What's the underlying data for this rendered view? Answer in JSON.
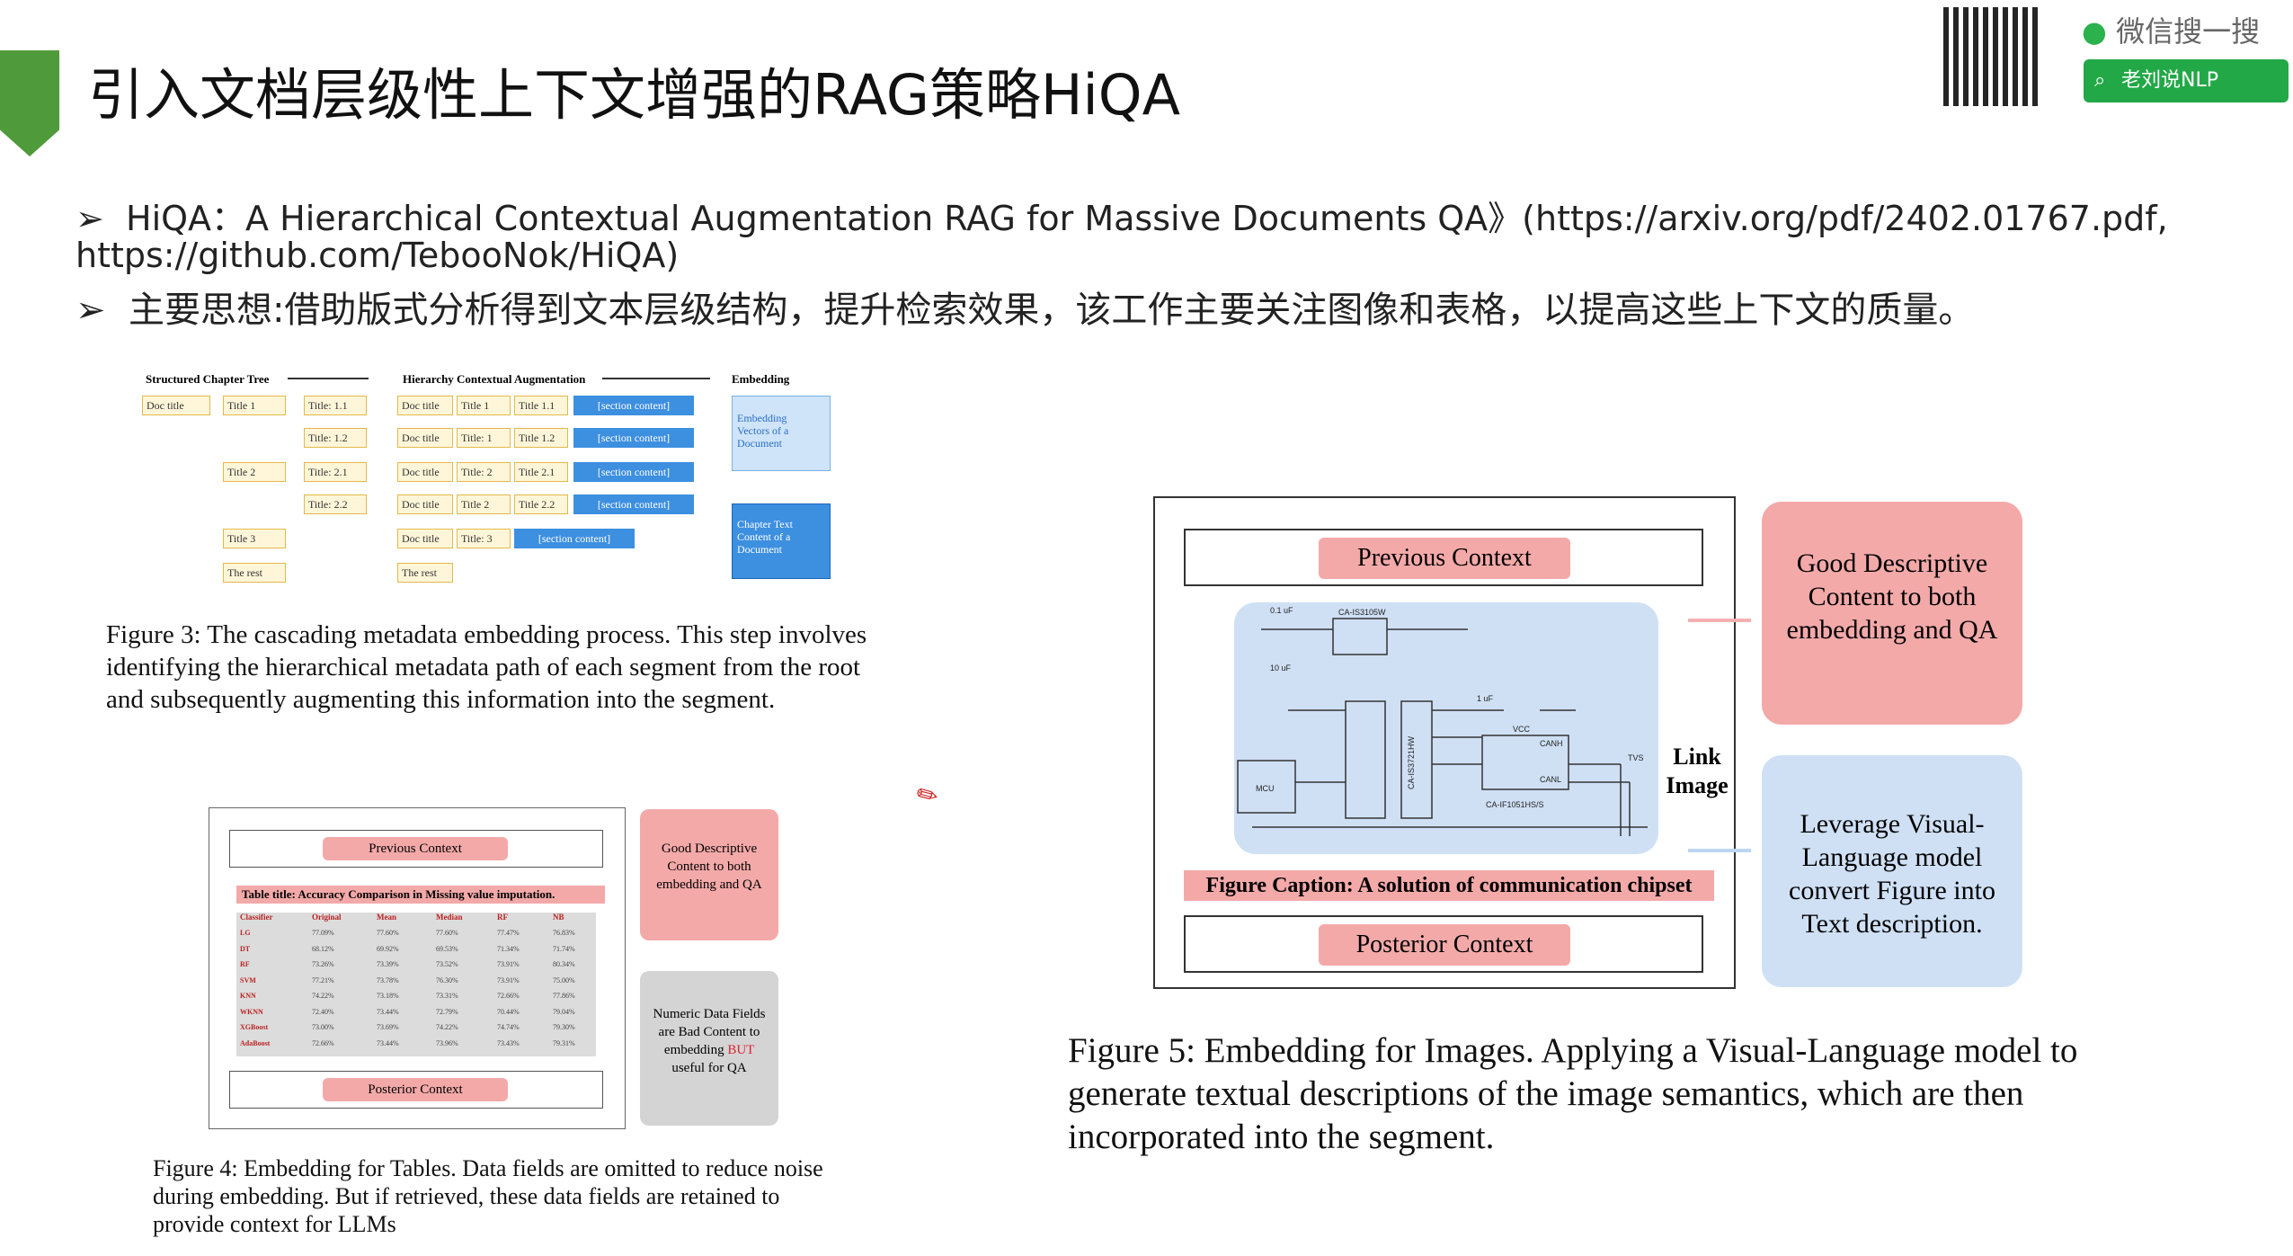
{
  "slide": {
    "title": "引入文档层级性上下文增强的RAG策略HiQA",
    "bullets": [
      "HiQA：A Hierarchical Contextual Augmentation RAG for Massive Documents QA》(https://arxiv.org/pdf/2402.01767.pdf,",
      "https://github.com/TebooNok/HiQA)",
      "主要思想:借助版式分析得到文本层级结构，提升检索效果，该工作主要关注图像和表格，以提高这些上下文的质量。"
    ],
    "bullet_symbol": "➢"
  },
  "watermark": {
    "qr_label": "qr-code",
    "wechat_text": "微信搜一搜",
    "search_label": "老刘说NLP"
  },
  "fig3": {
    "headers": [
      "Structured Chapter Tree",
      "Hierarchy Contextual Augmentation",
      "Embedding"
    ],
    "tree": [
      "Doc title",
      "Title 1",
      "Title: 1.1",
      "Title: 1.2",
      "Title 2",
      "Title: 2.1",
      "Title: 2.2",
      "Title 3",
      "The rest"
    ],
    "rows": [
      [
        "Doc title",
        "Title 1",
        "Title 1.1",
        "[section content]"
      ],
      [
        "Doc title",
        "Title: 1",
        "Title 1.2",
        "[section content]"
      ],
      [
        "Doc title",
        "Title: 2",
        "Title 2.1",
        "[section content]"
      ],
      [
        "Doc title",
        "Title 2",
        "Title 2.2",
        "[section content]"
      ],
      [
        "Doc title",
        "Title: 3",
        "[section content]"
      ],
      [
        "The rest"
      ]
    ],
    "emb1": "Embedding Vectors of a Document",
    "emb2": "Chapter Text Content of a Document",
    "caption": "Figure 3: The cascading metadata embedding process. This step involves identifying the hierarchical metadata path of each segment from the root and subsequently augmenting this information into the segment."
  },
  "fig4": {
    "prev": "Previous Context",
    "post": "Posterior Context",
    "table_title": "Table title: Accuracy Comparison in Missing value imputation.",
    "cols": [
      "Classifier",
      "Original",
      "Mean",
      "Median",
      "RF",
      "NB"
    ],
    "rows": [
      [
        "LG",
        "77.09%",
        "77.60%",
        "77.60%",
        "77.47%",
        "76.83%"
      ],
      [
        "DT",
        "68.12%",
        "69.92%",
        "69.53%",
        "71.34%",
        "71.74%"
      ],
      [
        "RF",
        "73.26%",
        "73.39%",
        "73.52%",
        "73.91%",
        "80.34%"
      ],
      [
        "SVM",
        "77.21%",
        "73.78%",
        "76.30%",
        "73.91%",
        "75.00%"
      ],
      [
        "KNN",
        "74.22%",
        "73.18%",
        "73.31%",
        "72.66%",
        "77.86%"
      ],
      [
        "WKNN",
        "72.40%",
        "73.44%",
        "72.79%",
        "70.44%",
        "79.04%"
      ],
      [
        "XGBoost",
        "73.00%",
        "73.69%",
        "74.22%",
        "74.74%",
        "79.30%"
      ],
      [
        "AdaBoost",
        "72.66%",
        "73.44%",
        "73.96%",
        "73.43%",
        "79.31%"
      ]
    ],
    "good": "Good Descriptive Content to both embedding and QA",
    "numeric_a": "Numeric Data Fields are Bad Content to embedding ",
    "numeric_but": "BUT",
    "numeric_b": " useful for QA",
    "caption": "Figure 4: Embedding for Tables. Data fields are omitted to reduce noise during embedding. But if retrieved, these data fields are retained to provide context for LLMs"
  },
  "fig5": {
    "prev": "Previous Context",
    "post": "Posterior Context",
    "fig_caption": "Figure Caption: A solution of communication chipset",
    "link": "Link Image",
    "good": "Good Descriptive Content to both embedding and QA",
    "leverage": "Leverage Visual-Language model convert Figure into Text description.",
    "circuit_labels": [
      "MCU",
      "CA-IS3105W",
      "CA-IS3721HW",
      "CA-IF1051HS/S",
      "VCC",
      "CANH",
      "CANL",
      "TVS",
      "0.1 uF",
      "10 uF",
      "1 uF"
    ],
    "caption": "Figure 5: Embedding for Images. Applying a Visual-Language model to generate textual descriptions of the image semantics, which are then incorporated into the segment."
  },
  "colors": {
    "accent_green": "#4f9a3a",
    "pink": "#f4a9a9",
    "light_blue": "#cfe0f5",
    "blue_cell": "#3d8fe0",
    "gray_box": "#d4d4d4"
  }
}
